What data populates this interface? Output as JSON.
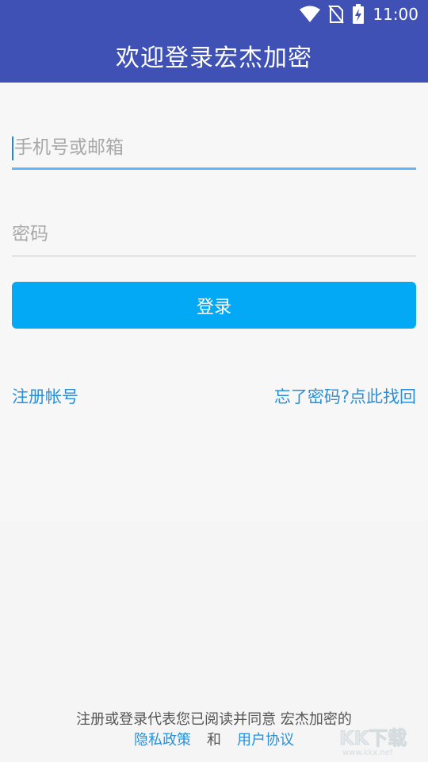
{
  "status_bar": {
    "time": "11:00",
    "icons": [
      "wifi-icon",
      "no-sim-icon",
      "battery-charging-icon"
    ]
  },
  "app_bar": {
    "title": "欢迎登录宏杰加密"
  },
  "form": {
    "phone": {
      "value": "",
      "placeholder": "手机号或邮箱"
    },
    "password": {
      "value": "",
      "placeholder": "密码"
    },
    "login_label": "登录"
  },
  "links": {
    "register": "注册帐号",
    "forgot_password": "忘了密码?点此找回"
  },
  "footer": {
    "agreement_text": "注册或登录代表您已阅读并同意 宏杰加密的",
    "privacy_policy": "隐私政策",
    "and": "和",
    "user_agreement": "用户协议"
  },
  "watermark": {
    "text": "KK下载",
    "site": "www.kkx.net"
  },
  "colors": {
    "primary": "#3f51b5",
    "button": "#03a9f4",
    "link": "#2b8fd8",
    "focus_underline": "#64b5f6"
  }
}
